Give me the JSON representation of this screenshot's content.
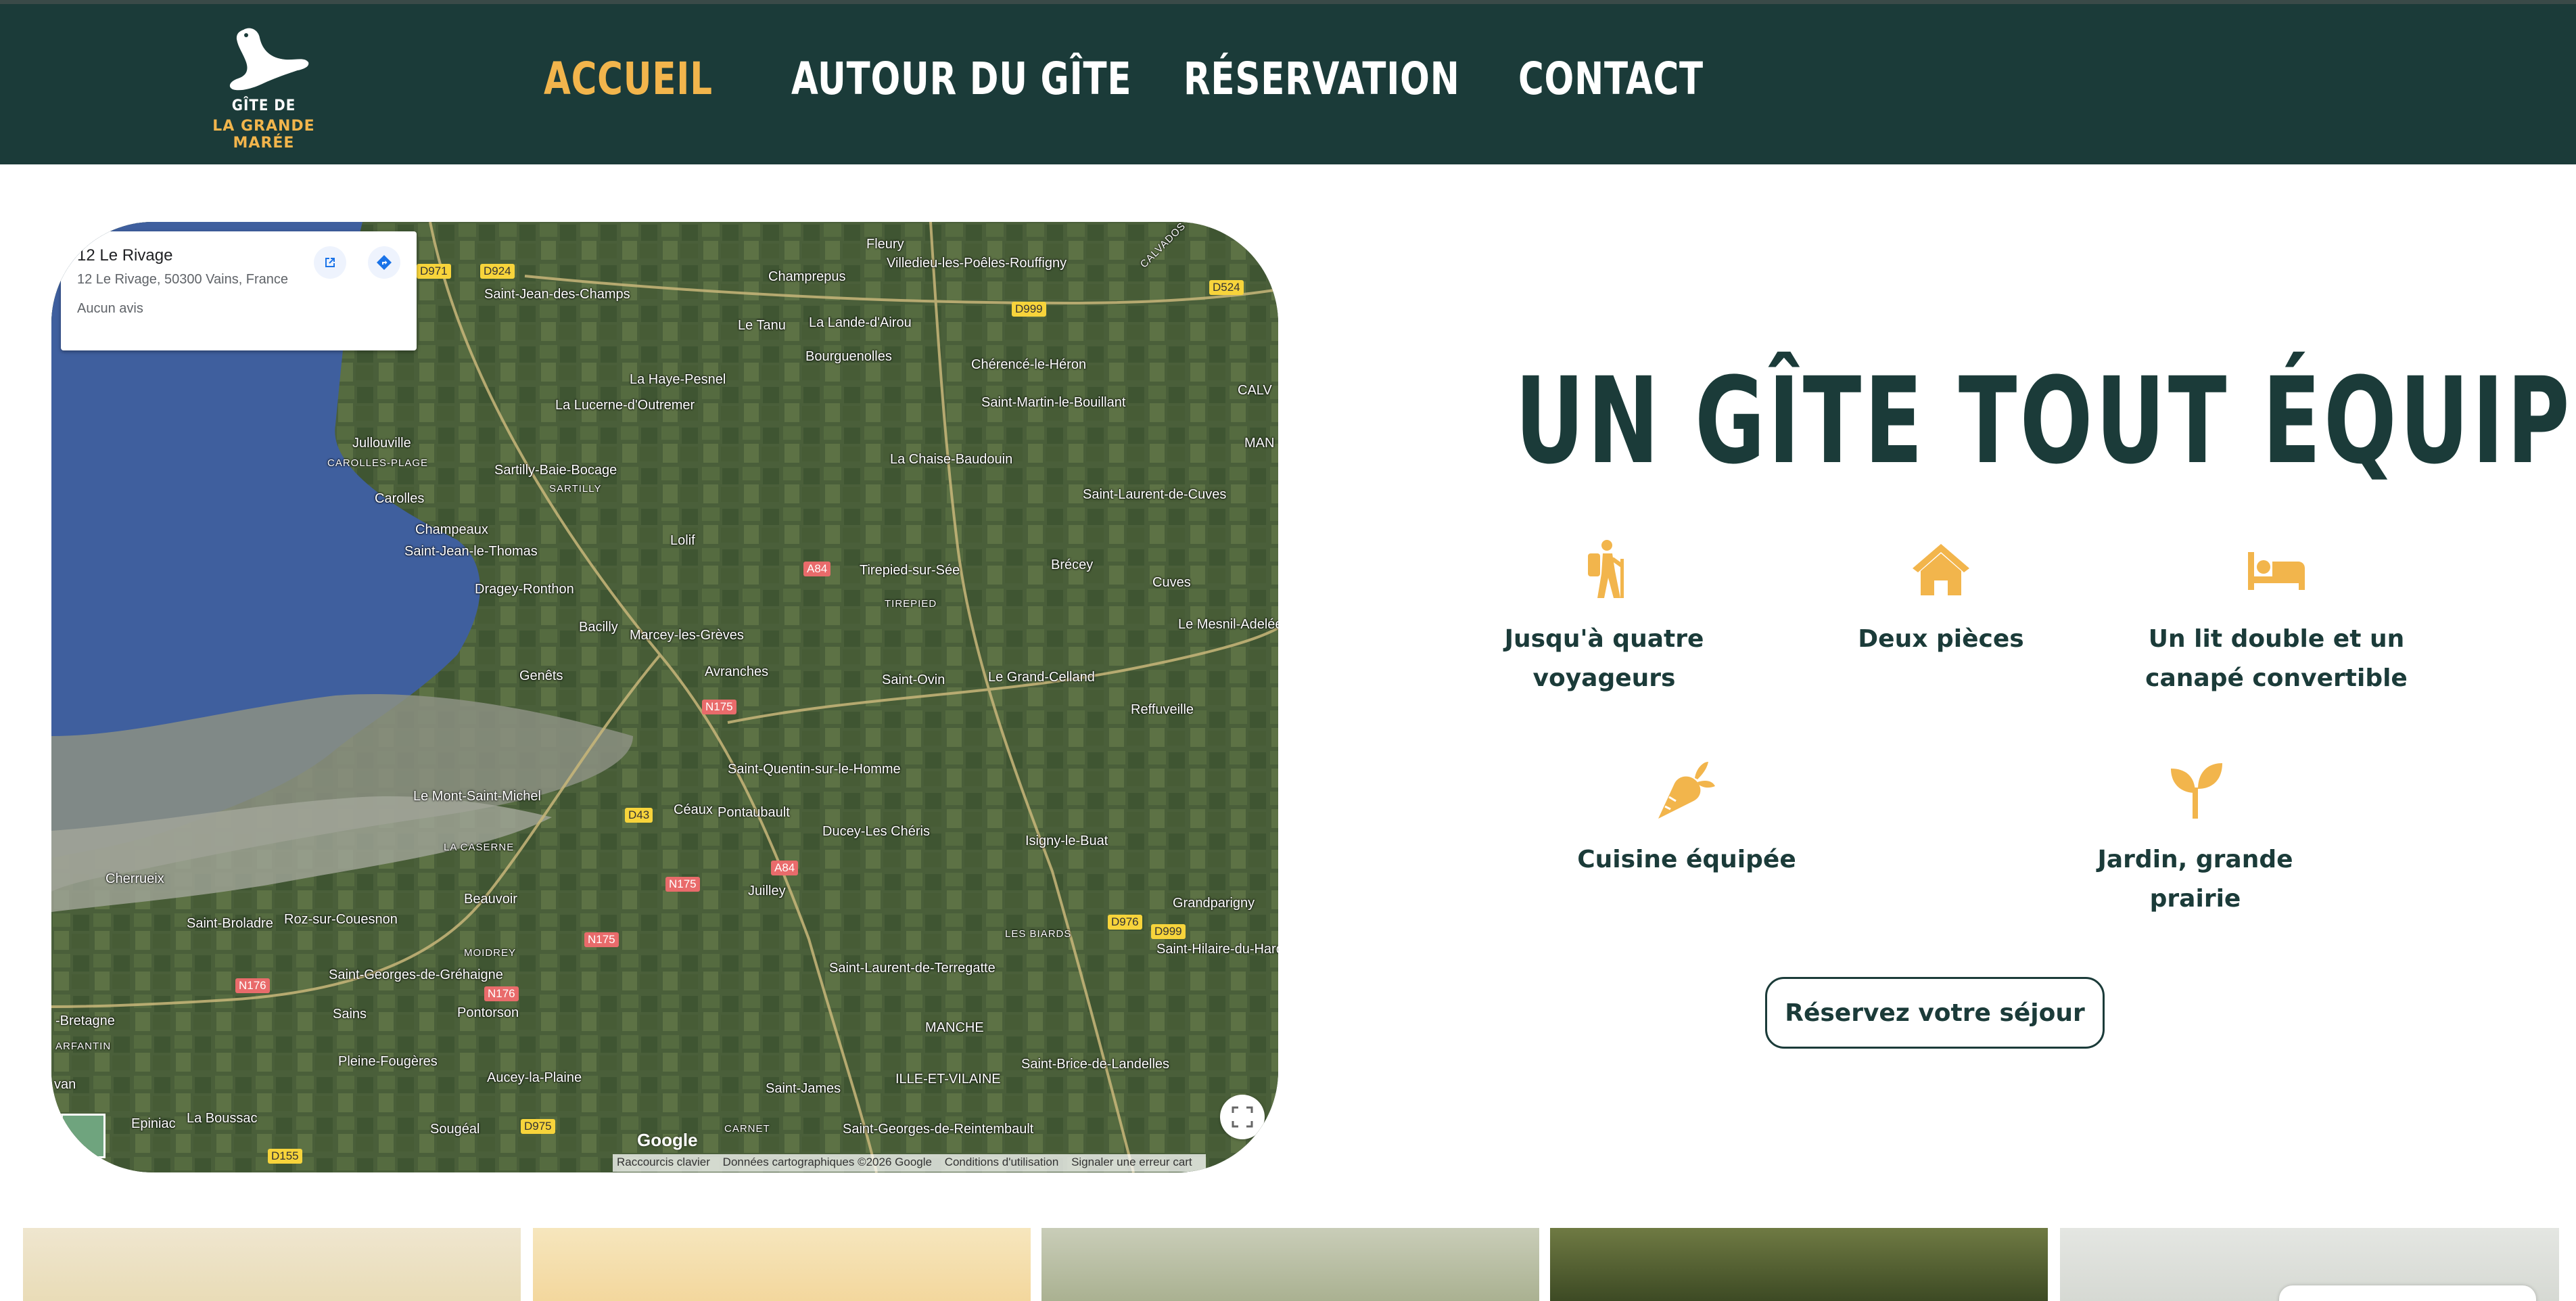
{
  "header": {
    "logo": {
      "line1": "GÎTE DE",
      "line2": "LA GRANDE MARÉE",
      "icon": "seal-icon"
    },
    "nav": [
      {
        "label": "ACCUEIL",
        "active": true
      },
      {
        "label": "AUTOUR DU GÎTE",
        "active": false
      },
      {
        "label": "RÉSERVATION",
        "active": false
      },
      {
        "label": "CONTACT",
        "active": false
      }
    ],
    "colors": {
      "background": "#1b3b39",
      "active": "#f2b54c",
      "text": "#ffffff"
    }
  },
  "map": {
    "place_title": "12 Le Rivage",
    "place_address": "12 Le Rivage, 50300 Vains, France",
    "reviews": "Aucun avis",
    "open_icon": "open-in-new-icon",
    "directions_icon": "directions-icon",
    "fullscreen_icon": "fullscreen-icon",
    "google": "Google",
    "attribution": [
      "Raccourcis clavier",
      "Données cartographiques ©2026 Google",
      "Conditions d'utilisation",
      "Signaler une erreur cart"
    ],
    "towns": [
      "Fleury",
      "Villedieu-les-Poêles-Rouffigny",
      "Champrepus",
      "Saint-Jean-des-Champs",
      "Le Tanu",
      "La Lande-d'Airou",
      "Bourguenolles",
      "Chérencé-le-Héron",
      "La Haye-Pesnel",
      "Saint-Martin-le-Bouillant",
      "La Lucerne-d'Outremer",
      "Jullouville",
      "CAROLLES-PLAGE",
      "Sartilly-Baie-Bocage",
      "SARTILLY",
      "La Chaise-Baudouin",
      "Carolles",
      "Saint-Laurent-de-Cuves",
      "Champeaux",
      "Lolif",
      "Saint-Jean-le-Thomas",
      "Tirepied-sur-Sée",
      "Brécey",
      "Dragey-Ronthon",
      "TIREPIED",
      "Cuves",
      "Bacilly",
      "Marcey-les-Grèves",
      "Le Mesnil-Adelée",
      "Genêts",
      "Avranches",
      "Saint-Ovin",
      "Le Grand-Celland",
      "Reffuveille",
      "Saint-Quentin-sur-le-Homme",
      "Le Mont-Saint-Michel",
      "Céaux",
      "Pontaubault",
      "Ducey-Les Chéris",
      "Isigny-le-Buat",
      "LA CASERNE",
      "Cherrueix",
      "Beauvoir",
      "Juilley",
      "Grandparigny",
      "Saint-Broladre",
      "Roz-sur-Couesnon",
      "LES BIARDS",
      "Saint-Hilaire-du-Harcouët",
      "MOIDREY",
      "Saint-Laurent-de-Terregatte",
      "Saint-Georges-de-Gréhaigne",
      "Sains",
      "Pontorson",
      "MANCHE",
      "-Bretagne",
      "ARFANTIN",
      "Pleine-Fougères",
      "Saint-Brice-de-Landelles",
      "Aucey-la-Plaine",
      "ILLE-ET-VILAINE",
      "Saint-James",
      "Epiniac",
      "La Boussac",
      "Sougéal",
      "CARNET",
      "Saint-Georges-de-Reintembault",
      "CALVADOS",
      "CALV",
      "MAN",
      "van"
    ],
    "roads": [
      "D971",
      "D924",
      "D999",
      "D524",
      "A84",
      "N175",
      "D43",
      "A84",
      "N175",
      "N175",
      "N176",
      "N176",
      "D976",
      "D999",
      "D975",
      "D155"
    ]
  },
  "main": {
    "headline": "UN GÎTE TOUT ÉQUIPÉ :",
    "features": [
      {
        "label": "Jusqu'à quatre voyageurs",
        "icon": "hiker-icon"
      },
      {
        "label": "Deux pièces",
        "icon": "house-icon"
      },
      {
        "label": "Un lit double et un canapé convertible",
        "icon": "bed-icon"
      },
      {
        "label": "Cuisine équipée",
        "icon": "carrot-icon"
      },
      {
        "label": "Jardin, grande prairie",
        "icon": "seedling-icon"
      }
    ],
    "cta": "Réservez votre séjour",
    "colors": {
      "headline": "#1b3b39",
      "icons": "#f2b54c"
    }
  }
}
